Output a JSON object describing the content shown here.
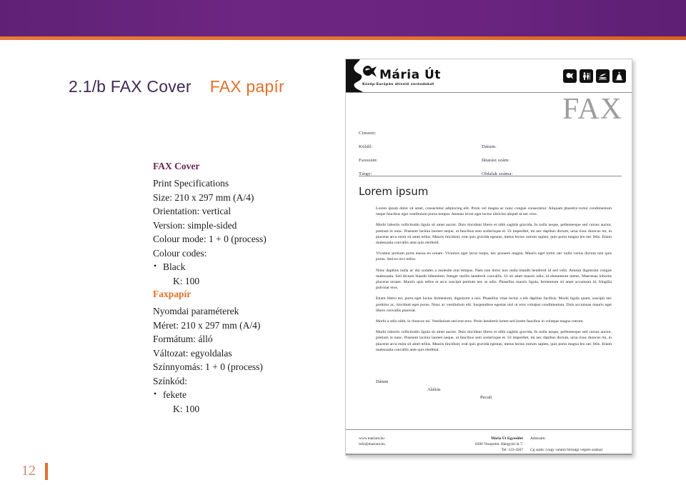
{
  "banner": {
    "accent_purple": "#6b2480",
    "accent_orange": "#e0712c"
  },
  "slide": {
    "title_main": "2.1/b FAX Cover",
    "title_alt": "FAX papír",
    "page_number": "12"
  },
  "spec_en": {
    "heading": "FAX Cover",
    "lines": [
      "Print Specifications",
      "Size: 210 x 297 mm (A/4)",
      "Orientation: vertical",
      "Version: simple-sided",
      "Colour mode: 1 + 0 (process)",
      "Colour codes:"
    ],
    "bullet": "Black",
    "sub": "K: 100"
  },
  "spec_hu": {
    "heading": "Faxpapír",
    "lines": [
      "Nyomdai paraméterek",
      "Méret: 210 x 297 mm (A/4)",
      "Formátum: álló",
      "Változat: egyoldalas",
      "Színnyomás: 1 + 0 (process)",
      "Színkód:"
    ],
    "bullet": "fekete",
    "sub": "K: 100"
  },
  "document": {
    "logo_word": "Mária Út",
    "logo_tagline": "Közép-Európán átívelő zarándokút",
    "wordmark": "FAX",
    "icons": [
      "maria-ut-mark-icon",
      "pilgrims-icon",
      "boat-icon",
      "chapel-icon"
    ],
    "fields_left": [
      "Címzett:",
      "Küldő:",
      "Faxszám:",
      "Tárgy:"
    ],
    "fields_right": [
      "",
      "Dátum:",
      "Iktatási szám:",
      "Oldalak száma:"
    ],
    "doc_title": "Lorem ipsum",
    "paragraphs": [
      "Lorem ipsum dolor sit amet, consectetur adipiscing elit. Proin vel magna ac nunc congue consectetur. Aliquam pharetra tortor condimentum neque faucibus eget vestibulum purus tempor. Aenean id est eget lectus ultricies aliquet at nec eros.",
      "Morbi lobortis sollicitudin ligula sit amet auctor. Duis tincidunt libero et nibh sagittis gravida. In nulla neque, pellentesque sed cursus auctor, pretium in nunc. Praesent lacinia laoreet neque, ut faucibus sem scelerisque et. Ut imperdiet, mi nec dapibus dictum, urna risus rhoncus mi, in placerat arcu enim sit amet tellus. Mauris tincidunt, erat quis gravida egestas, metus lectus rutrum sapien, quis porta magna leo nec felis. Etiam malesuada convallis ante quis eleifend.",
      "Vivamus pretium porta massa eu ornare. Vivamus eget lacus turpis, nec posuere magna. Mauris eget tortor nec nulla varius dictum non quis purus. Sed eu orci tellus.",
      "Nunc dapibus nulla ac dui sodales a molestie erat tempus. Nam non dolor non nulla blandit hendrerit id sed velit. Aenean dignissim congue malesuada. Sed dictum blandit bibendum. Integer mollis hendrerit convallis. Ut sit amet mauris odio, id elementum metus. Maecenas lobortis placerat ornare. Mauris quis tellus et arcu suscipit pretium nec ut odio. Phasellus mauris ligula, fermentum sit amet accumsan id, fringilla pulvinar eros.",
      "Etiam libero est, porta eget luctus fermentum, dignissim a nisi. Phasellus vitae lectus a elit dapibus facilisis. Morbi ligula quam, suscipit nec porttitor ac, tincidunt eget purus. Nunc ac vestibulum elit. Suspendisse egestas nisl ut eros volutpat condimentum. Duis accumsan mauris eget libero convallis placerat.",
      "Morbi a odio nibh, in rhoncus mi. Vestibulum sed erat eros. Proin hendrerit lorem sed lorem faucibus in volutpat magna rutrum.",
      "Morbi lobortis sollicitudin ligula sit amet auctor. Duis tincidunt libero et nibh sagittis gravida. In nulla neque, pellentesque sed cursus auctor, pretium in nunc. Praesent lacinia laoreet neque, ut faucibus sem scelerisque et. Ut imperdiet, mi nec dapibus dictum, urna risus rhoncus mi, in placerat arcu enim sit amet tellus. Mauris tincidunt, erat quis gravida egestas, metus lectus rutrum sapien, quis porta magna leo nec felis. Etiam malesuada convallis ante quis eleifend."
    ],
    "signature": {
      "date": "Dátum",
      "sign": "Aláírás",
      "seal": "Pecsét"
    },
    "footer": {
      "web": "www.mariaut.hu",
      "email": "info@mariaut.hu",
      "org": "Mária Út Egyesület",
      "address": "8200 Veszprém, Hángyári út 7.",
      "phone": "Tel: 123-4567",
      "tax_label": "Adószám:",
      "reg_label": "Cg szám: (vagy valami bírósági végzés száma)"
    }
  }
}
